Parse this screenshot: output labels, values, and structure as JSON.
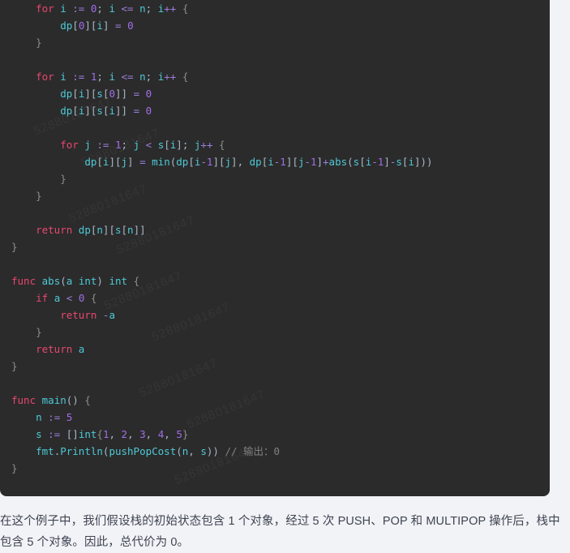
{
  "code_block": {
    "language": "go",
    "background_color": "#2b2b2b",
    "watermark_text": "52880181647",
    "lines": [
      "    for i := 0; i <= n; i++ {",
      "        dp[0][i] = 0",
      "    }",
      "",
      "    for i := 1; i <= n; i++ {",
      "        dp[i][s[0]] = 0",
      "        dp[i][s[i]] = 0",
      "",
      "        for j := 1; j < s[i]; j++ {",
      "            dp[i][j] = min(dp[i-1][j], dp[i-1][j-1]+abs(s[i-1]-s[i]))",
      "        }",
      "    }",
      "",
      "    return dp[n][s[n]]",
      "}",
      "",
      "func abs(a int) int {",
      "    if a < 0 {",
      "        return -a",
      "    }",
      "    return a",
      "}",
      "",
      "func main() {",
      "    n := 5",
      "    s := []int{1, 2, 3, 4, 5}",
      "    fmt.Println(pushPopCost(n, s)) // 输出：0",
      "}"
    ],
    "comment_text": "// 输出：0",
    "colors": {
      "keyword": "#e8476f",
      "identifier": "#4ec9d6",
      "operator": "#9b7ede",
      "number": "#a06ee8",
      "punctuation": "#a9b7c6",
      "brace": "#8d8d8d",
      "comment": "#808080"
    }
  },
  "paragraph": {
    "text": "在这个例子中，我们假设栈的初始状态包含 1 个对象，经过 5 次 PUSH、POP 和 MULTIPOP 操作后，栈中包含 5 个对象。因此，总代价为 0。"
  },
  "page": {
    "background_color": "#f1f3f7"
  }
}
